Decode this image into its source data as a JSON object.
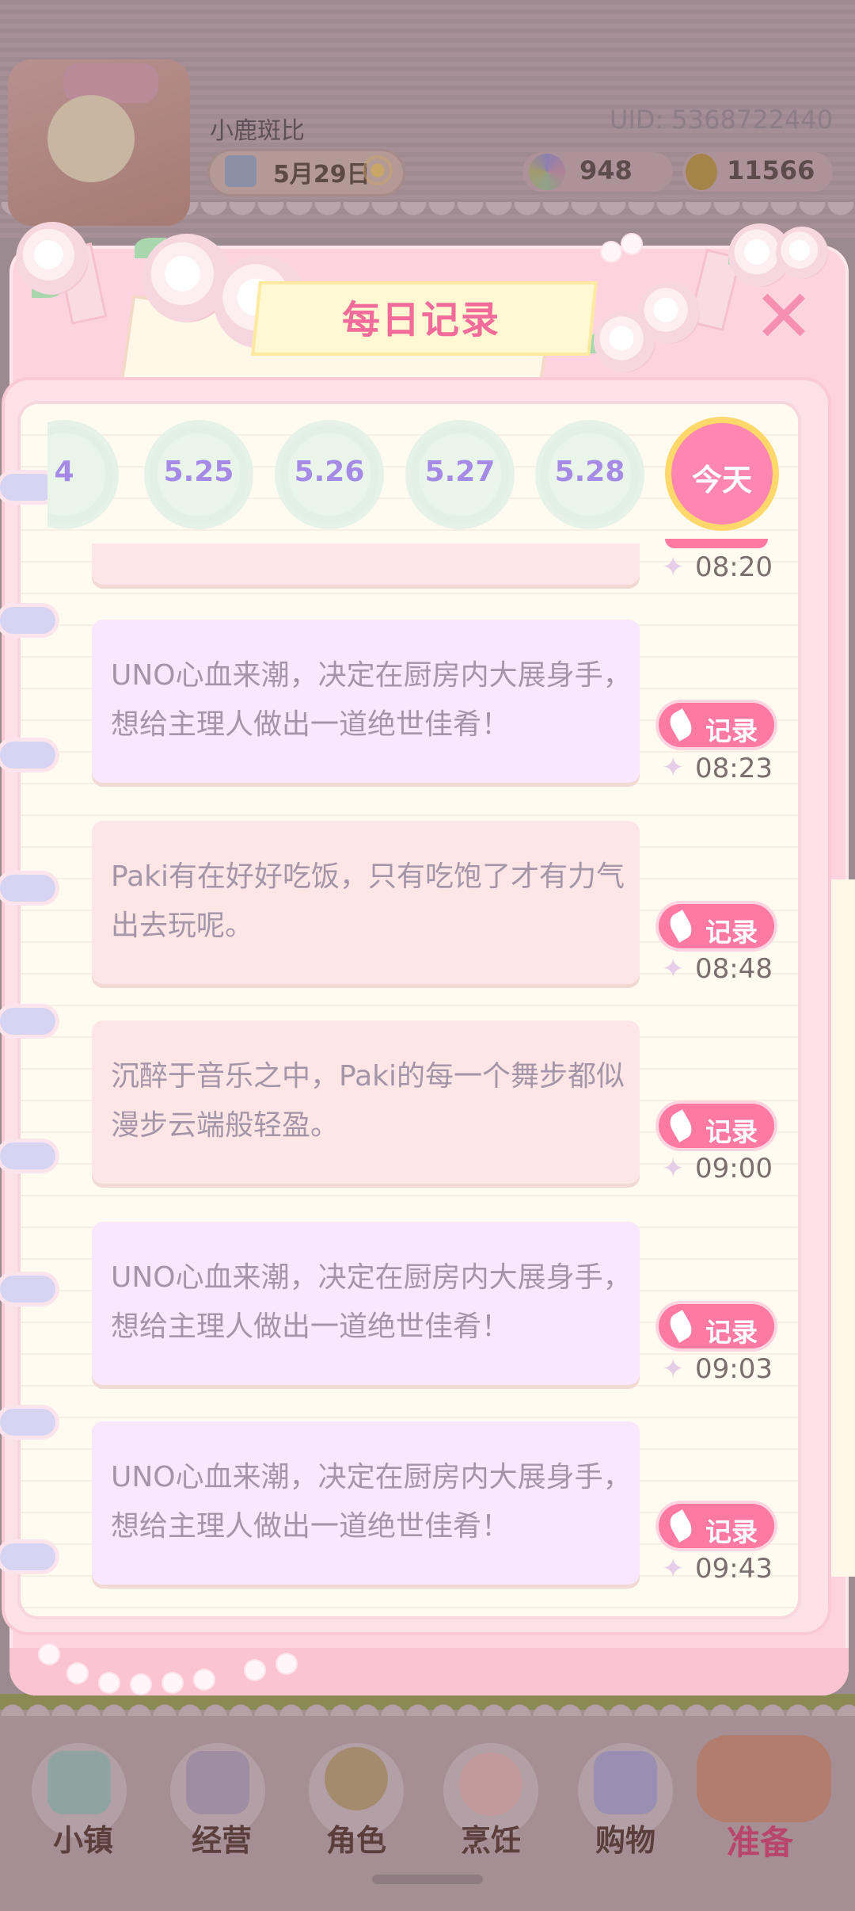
{
  "header": {
    "player_name": "小鹿斑比",
    "uid": "UID: 5368722440",
    "date": "5月29日",
    "flowers": "948",
    "coins": "11566"
  },
  "dialog": {
    "title": "每日记录",
    "close_label": "✕"
  },
  "date_tabs": [
    {
      "label": "4"
    },
    {
      "label": "5.25"
    },
    {
      "label": "5.26"
    },
    {
      "label": "5.27"
    },
    {
      "label": "5.28"
    },
    {
      "label": "今天",
      "selected": true
    }
  ],
  "record_button_label": "记录",
  "entries": [
    {
      "text": "",
      "time": "08:20",
      "color": "pink"
    },
    {
      "text": "UNO心血来潮，决定在厨房内大展身手，想给主理人做出一道绝世佳肴！",
      "time": "08:23",
      "color": "lavender"
    },
    {
      "text": "Paki有在好好吃饭，只有吃饱了才有力气出去玩呢。",
      "time": "08:48",
      "color": "pink"
    },
    {
      "text": "沉醉于音乐之中，Paki的每一个舞步都似漫步云端般轻盈。",
      "time": "09:00",
      "color": "pink"
    },
    {
      "text": "UNO心血来潮，决定在厨房内大展身手，想给主理人做出一道绝世佳肴！",
      "time": "09:03",
      "color": "lavender"
    },
    {
      "text": "UNO心血来潮，决定在厨房内大展身手，想给主理人做出一道绝世佳肴！",
      "time": "09:43",
      "color": "lavender"
    }
  ],
  "nav": [
    {
      "label": "小镇",
      "icon": "map-icon"
    },
    {
      "label": "经营",
      "icon": "shop-bag-icon"
    },
    {
      "label": "角色",
      "icon": "character-icon"
    },
    {
      "label": "烹饪",
      "icon": "cooking-icon"
    },
    {
      "label": "购物",
      "icon": "shopping-bag-icon"
    },
    {
      "label": "准备",
      "icon": "basket-icon",
      "active": true
    }
  ],
  "colors": {
    "accent_pink": "#ff7aa3",
    "title_pink": "#f16c9b",
    "date_purple": "#a58ae6",
    "today_ring": "#ffd86b"
  }
}
